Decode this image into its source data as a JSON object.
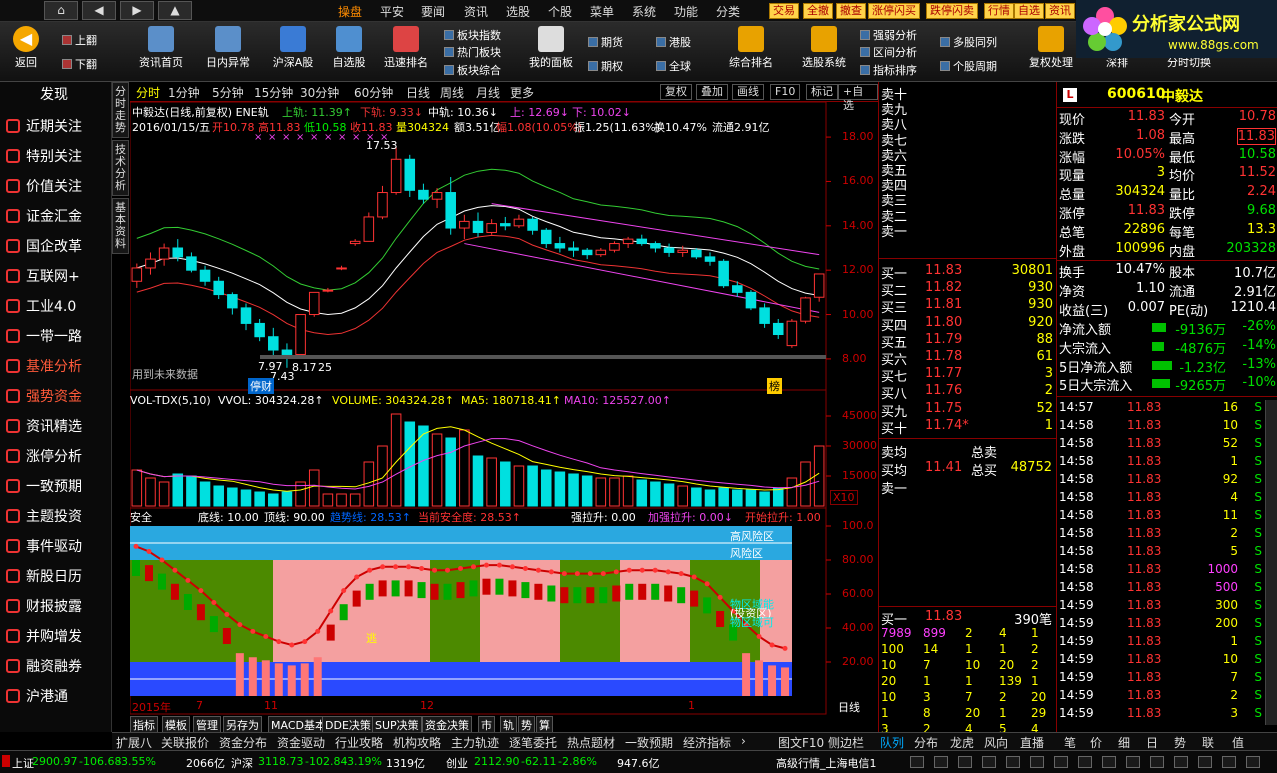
{
  "menubar": {
    "nav": [
      "⌂",
      "◀",
      "▶",
      "▲"
    ],
    "items": [
      "操盘",
      "平安",
      "要闻",
      "资讯",
      "选股",
      "个股",
      "菜单",
      "系统",
      "功能",
      "分类"
    ],
    "active": "操盘",
    "quick": [
      "交易",
      "全撤",
      "撤查",
      "涨停闪买",
      "跌停闪卖",
      "行情",
      "自选",
      "资讯"
    ]
  },
  "toolbar": {
    "back": "返回",
    "page_up": "上翻",
    "page_down": "下翻",
    "big": [
      "资讯首页",
      "日内异常",
      "沪深A股",
      "自选股",
      "迅速排名",
      "我的面板",
      "综合排名",
      "选股系统",
      "复权处理",
      "深排",
      "分时切换"
    ],
    "small": [
      "板块指数",
      "热门板块",
      "板块综合",
      "期货",
      "期权",
      "港股",
      "全球",
      "强弱分析",
      "区间分析",
      "指标排序",
      "多股同列",
      "个股周期"
    ]
  },
  "logo": {
    "title": "分析家公式网",
    "url": "www.88gs.com"
  },
  "sidebar": {
    "title": "发现",
    "items": [
      "近期关注",
      "特别关注",
      "价值关注",
      "证金汇金",
      "国企改革",
      "互联网+",
      "工业4.0",
      "一带一路",
      "基准分析",
      "强势资金",
      "资讯精选",
      "涨停分析",
      "一致预期",
      "主题投资",
      "事件驱动",
      "新股日历",
      "财报披露",
      "并购增发",
      "融资融券",
      "沪港通"
    ]
  },
  "vtabs": [
    "分时走势",
    "技术分析",
    "基本资料"
  ],
  "periods": [
    "分时",
    "1分钟",
    "5分钟",
    "15分钟",
    "30分钟",
    "60分钟",
    "日线",
    "周线",
    "月线",
    "更多"
  ],
  "period_active": "分时",
  "chart_tools": [
    "复权",
    "叠加",
    "画线",
    "F10",
    "标记",
    "+自选"
  ],
  "main_chart": {
    "header": "中毅达(日线,前复权) ENE轨",
    "upper": "上轨: 11.39↑",
    "lower": "下轨: 9.33↓",
    "mid": "中轨: 10.36↓",
    "up2": "上: 12.69↓",
    "down2": "下: 10.02↓",
    "ohlc_date": "2016/01/15/五",
    "open": "开10.78",
    "high": "高11.83",
    "low": "低10.58",
    "close": "收11.83",
    "vol": "量304324",
    "amt": "额3.51亿",
    "chg": "幅1.08(10.05%)",
    "amp": "振1.25(11.63%)",
    "turn": "换10.47%",
    "float": "流通2.91亿",
    "y_ticks": [
      "18.00",
      "16.00",
      "14.00",
      "12.00",
      "10.00",
      "8.00"
    ],
    "y_range": [
      7.5,
      18.5
    ],
    "annotations": {
      "peak": "17.53",
      "low1": "7.97",
      "low2": "8.17",
      "low3": "7.43",
      "low4": "25",
      "future": "用到未来数据",
      "stop": "停财",
      "tag": "榜"
    }
  },
  "candles": [
    {
      "o": 11.5,
      "h": 12.3,
      "l": 11.2,
      "c": 12.1
    },
    {
      "o": 12.1,
      "h": 12.8,
      "l": 11.8,
      "c": 12.5
    },
    {
      "o": 12.5,
      "h": 13.2,
      "l": 12.2,
      "c": 13.0
    },
    {
      "o": 13.0,
      "h": 13.4,
      "l": 12.4,
      "c": 12.6
    },
    {
      "o": 12.6,
      "h": 12.8,
      "l": 11.9,
      "c": 12.0
    },
    {
      "o": 12.0,
      "h": 12.2,
      "l": 11.3,
      "c": 11.5
    },
    {
      "o": 11.5,
      "h": 11.7,
      "l": 10.7,
      "c": 10.9
    },
    {
      "o": 10.9,
      "h": 11.0,
      "l": 10.0,
      "c": 10.3
    },
    {
      "o": 10.3,
      "h": 10.5,
      "l": 9.3,
      "c": 9.6
    },
    {
      "o": 9.6,
      "h": 9.8,
      "l": 8.8,
      "c": 9.0
    },
    {
      "o": 9.0,
      "h": 9.4,
      "l": 8.1,
      "c": 8.4
    },
    {
      "o": 8.4,
      "h": 8.7,
      "l": 7.6,
      "c": 8.2
    },
    {
      "o": 8.2,
      "h": 10.0,
      "l": 8.2,
      "c": 10.0
    },
    {
      "o": 10.0,
      "h": 11.0,
      "l": 9.9,
      "c": 11.0
    },
    {
      "o": 11.1,
      "h": 11.2,
      "l": 11.0,
      "c": 11.1
    },
    {
      "o": 12.1,
      "h": 12.2,
      "l": 12.0,
      "c": 12.1
    },
    {
      "o": 13.2,
      "h": 13.4,
      "l": 13.1,
      "c": 13.3
    },
    {
      "o": 13.3,
      "h": 14.6,
      "l": 13.3,
      "c": 14.4
    },
    {
      "o": 14.4,
      "h": 15.8,
      "l": 14.3,
      "c": 15.5
    },
    {
      "o": 15.5,
      "h": 17.53,
      "l": 15.4,
      "c": 17.0
    },
    {
      "o": 17.0,
      "h": 17.2,
      "l": 15.3,
      "c": 15.6
    },
    {
      "o": 15.6,
      "h": 15.9,
      "l": 15.0,
      "c": 15.2
    },
    {
      "o": 15.2,
      "h": 15.7,
      "l": 14.8,
      "c": 15.5
    },
    {
      "o": 15.5,
      "h": 16.2,
      "l": 13.6,
      "c": 13.9
    },
    {
      "o": 13.9,
      "h": 14.5,
      "l": 13.4,
      "c": 14.2
    },
    {
      "o": 14.2,
      "h": 14.6,
      "l": 13.5,
      "c": 13.7
    },
    {
      "o": 13.7,
      "h": 14.3,
      "l": 13.6,
      "c": 14.1
    },
    {
      "o": 14.1,
      "h": 14.4,
      "l": 13.8,
      "c": 14.0
    },
    {
      "o": 14.0,
      "h": 14.5,
      "l": 13.9,
      "c": 14.3
    },
    {
      "o": 14.3,
      "h": 14.4,
      "l": 13.6,
      "c": 13.8
    },
    {
      "o": 13.8,
      "h": 13.9,
      "l": 13.0,
      "c": 13.2
    },
    {
      "o": 13.2,
      "h": 13.5,
      "l": 12.8,
      "c": 13.0
    },
    {
      "o": 13.0,
      "h": 13.3,
      "l": 12.6,
      "c": 12.9
    },
    {
      "o": 12.9,
      "h": 13.0,
      "l": 12.5,
      "c": 12.7
    },
    {
      "o": 12.7,
      "h": 13.0,
      "l": 12.6,
      "c": 12.9
    },
    {
      "o": 12.9,
      "h": 13.3,
      "l": 12.8,
      "c": 13.2
    },
    {
      "o": 13.2,
      "h": 13.5,
      "l": 13.0,
      "c": 13.4
    },
    {
      "o": 13.4,
      "h": 13.6,
      "l": 13.1,
      "c": 13.2
    },
    {
      "o": 13.2,
      "h": 13.3,
      "l": 12.8,
      "c": 13.0
    },
    {
      "o": 13.0,
      "h": 13.2,
      "l": 12.6,
      "c": 12.8
    },
    {
      "o": 12.8,
      "h": 13.1,
      "l": 12.6,
      "c": 12.9
    },
    {
      "o": 12.9,
      "h": 13.0,
      "l": 12.5,
      "c": 12.6
    },
    {
      "o": 12.6,
      "h": 12.8,
      "l": 12.2,
      "c": 12.4
    },
    {
      "o": 12.4,
      "h": 12.5,
      "l": 11.2,
      "c": 11.3
    },
    {
      "o": 11.3,
      "h": 11.5,
      "l": 10.8,
      "c": 11.0
    },
    {
      "o": 11.0,
      "h": 11.1,
      "l": 10.2,
      "c": 10.3
    },
    {
      "o": 10.3,
      "h": 10.5,
      "l": 9.4,
      "c": 9.6
    },
    {
      "o": 9.6,
      "h": 9.8,
      "l": 8.9,
      "c": 9.1
    },
    {
      "o": 8.6,
      "h": 9.8,
      "l": 8.5,
      "c": 9.7
    },
    {
      "o": 9.7,
      "h": 10.8,
      "l": 9.6,
      "c": 10.75
    },
    {
      "o": 10.78,
      "h": 11.83,
      "l": 10.58,
      "c": 11.83
    }
  ],
  "volume": {
    "header": "VOL-TDX(5,10)",
    "vvol": "VVOL: 304324.28↑",
    "volume": "VOLUME: 304324.28↑",
    "ma5": "MA5: 180718.41↑",
    "ma10": "MA10: 125527.00↑",
    "y_ticks": [
      "45000",
      "30000",
      "15000"
    ],
    "unit": "X10",
    "values": [
      18,
      14,
      12,
      16,
      15,
      12,
      10,
      9,
      8,
      7,
      6,
      7,
      12,
      18,
      6,
      6,
      6,
      22,
      30,
      46,
      42,
      40,
      36,
      34,
      38,
      25,
      24,
      22,
      20,
      20,
      18,
      17,
      16,
      15,
      14,
      14,
      15,
      13,
      12,
      11,
      10,
      9,
      8,
      9,
      8,
      8,
      7,
      9,
      14,
      22,
      30
    ]
  },
  "safety": {
    "header": "安全",
    "bottom": "底线: 10.00",
    "top": "顶线: 90.00",
    "trend": "趋势线: 28.53↑",
    "safe": "当前安全度: 28.53↑",
    "strong": "强拉升: 0.00",
    "accel": "加强拉升: 0.00↓",
    "start": "开始拉升: 1.00",
    "zones": [
      "高风险区",
      "风险区"
    ],
    "notes": [
      "物区域能",
      "(投资区)",
      "物区域可"
    ],
    "escape": "逃",
    "y_ticks": [
      "100.0",
      "80.00",
      "60.00",
      "40.00",
      "20.00"
    ],
    "line": [
      88,
      85,
      80,
      74,
      68,
      62,
      55,
      48,
      42,
      38,
      35,
      32,
      30,
      32,
      38,
      50,
      62,
      70,
      74,
      76,
      76,
      76,
      75,
      74,
      74,
      75,
      76,
      77,
      77,
      76,
      75,
      74,
      73,
      72,
      72,
      72,
      72,
      73,
      74,
      74,
      74,
      73,
      72,
      70,
      66,
      58,
      50,
      42,
      35,
      30,
      28
    ]
  },
  "x_axis": {
    "labels": [
      "2015年",
      "7",
      "11",
      "12",
      "1"
    ],
    "period": "日线"
  },
  "index_tabs": [
    "指标",
    "模板",
    "管理",
    "另存为",
    "MACD基本",
    "DDE决策",
    "SUP决策",
    "资金决策",
    "市",
    "轨",
    "势",
    "算"
  ],
  "quote": {
    "sells": [
      "卖十",
      "卖九",
      "卖八",
      "卖七",
      "卖六",
      "卖五",
      "卖四",
      "卖三",
      "卖二",
      "卖一"
    ],
    "buys": [
      {
        "n": "买一",
        "p": "11.83",
        "v": "30801"
      },
      {
        "n": "买二",
        "p": "11.82",
        "v": "930"
      },
      {
        "n": "买三",
        "p": "11.81",
        "v": "930"
      },
      {
        "n": "买四",
        "p": "11.80",
        "v": "920"
      },
      {
        "n": "买五",
        "p": "11.79",
        "v": "88"
      },
      {
        "n": "买六",
        "p": "11.78",
        "v": "61"
      },
      {
        "n": "买七",
        "p": "11.77",
        "v": "3"
      },
      {
        "n": "买八",
        "p": "11.76",
        "v": "2"
      },
      {
        "n": "买九",
        "p": "11.75",
        "v": "52"
      },
      {
        "n": "买十",
        "p": "11.74*",
        "v": "1"
      }
    ],
    "avg_sell": "卖均",
    "total_sell": "总卖",
    "avg_buy": "买均",
    "avg_buy_p": "11.41",
    "total_buy": "总买",
    "total_buy_v": "48752",
    "sell1b": "卖一",
    "buy1": {
      "n": "买一",
      "p": "11.83",
      "v": "390笔"
    },
    "queue": [
      [
        "7989",
        "899",
        "2",
        "4",
        "1"
      ],
      [
        "100",
        "14",
        "1",
        "1",
        "2"
      ],
      [
        "10",
        "7",
        "10",
        "20",
        "2"
      ],
      [
        "20",
        "1",
        "1",
        "139",
        "1"
      ],
      [
        "10",
        "3",
        "7",
        "2",
        "20"
      ],
      [
        "1",
        "8",
        "20",
        "1",
        "29"
      ],
      [
        "3",
        "2",
        "4",
        "5",
        "4"
      ]
    ]
  },
  "info": {
    "code": "600610",
    "name": "中毅达",
    "rows": [
      [
        "现价",
        "11.83",
        "今开",
        "10.78"
      ],
      [
        "涨跌",
        "1.08",
        "最高",
        "11.83"
      ],
      [
        "涨幅",
        "10.05%",
        "最低",
        "10.58"
      ],
      [
        "现量",
        "3",
        "均价",
        "11.52"
      ],
      [
        "总量",
        "304324",
        "量比",
        "2.24"
      ],
      [
        "涨停",
        "11.83",
        "跌停",
        "9.68"
      ],
      [
        "总笔",
        "22896",
        "每笔",
        "13.3"
      ],
      [
        "外盘",
        "100996",
        "内盘",
        "203328"
      ]
    ],
    "rows2": [
      [
        "换手",
        "10.47%",
        "股本",
        "10.7亿"
      ],
      [
        "净资",
        "1.10",
        "流通",
        "2.91亿"
      ],
      [
        "收益(三)",
        "0.007",
        "PE(动)",
        "1210.4"
      ]
    ],
    "flows": [
      [
        "净流入额",
        "-9136万",
        "-26%"
      ],
      [
        "大宗流入",
        "-4876万",
        "-14%"
      ],
      [
        "5日净流入额",
        "-1.23亿",
        "-13%"
      ],
      [
        "5日大宗流入",
        "-9265万",
        "-10%"
      ]
    ],
    "ticks": [
      [
        "14:57",
        "11.83",
        "16",
        "S"
      ],
      [
        "14:58",
        "11.83",
        "10",
        "S"
      ],
      [
        "14:58",
        "11.83",
        "52",
        "S"
      ],
      [
        "14:58",
        "11.83",
        "1",
        "S"
      ],
      [
        "14:58",
        "11.83",
        "92",
        "S"
      ],
      [
        "14:58",
        "11.83",
        "4",
        "S"
      ],
      [
        "14:58",
        "11.83",
        "11",
        "S"
      ],
      [
        "14:58",
        "11.83",
        "2",
        "S"
      ],
      [
        "14:58",
        "11.83",
        "5",
        "S"
      ],
      [
        "14:58",
        "11.83",
        "1000",
        "S"
      ],
      [
        "14:58",
        "11.83",
        "500",
        "S"
      ],
      [
        "14:59",
        "11.83",
        "300",
        "S"
      ],
      [
        "14:59",
        "11.83",
        "200",
        "S"
      ],
      [
        "14:59",
        "11.83",
        "1",
        "S"
      ],
      [
        "14:59",
        "11.83",
        "10",
        "S"
      ],
      [
        "14:59",
        "11.83",
        "7",
        "S"
      ],
      [
        "14:59",
        "11.83",
        "2",
        "S"
      ],
      [
        "14:59",
        "11.83",
        "3",
        "S"
      ]
    ]
  },
  "bottom_tabs": [
    "扩展八",
    "关联报价",
    "资金分布",
    "资金驱动",
    "行业攻略",
    "机构攻略",
    "主力轨迹",
    "逐笔委托",
    "热点题材",
    "一致预期",
    "经济指标"
  ],
  "bottom_right_left": [
    "图文F10",
    "侧边栏"
  ],
  "right_tabs": [
    "队列",
    "分布",
    "龙虎",
    "风向",
    "直播",
    "笔",
    "价",
    "细",
    "日",
    "势",
    "联",
    "值"
  ],
  "status": {
    "sh_label": "上证",
    "sh": "2900.97",
    "sh_chg": "-106.68",
    "sh_pct": "-3.55%",
    "sh_amt": "2066亿",
    "sz_label": "沪深",
    "sz": "3118.73",
    "sz_chg": "-102.84",
    "sz_pct": "-3.19%",
    "sz_amt": "1319亿",
    "cy_label": "创业",
    "cy": "2112.90",
    "cy_chg": "-62.11",
    "cy_pct": "-2.86%",
    "cy_amt": "947.6亿",
    "feed": "高级行情_上海电信1"
  }
}
